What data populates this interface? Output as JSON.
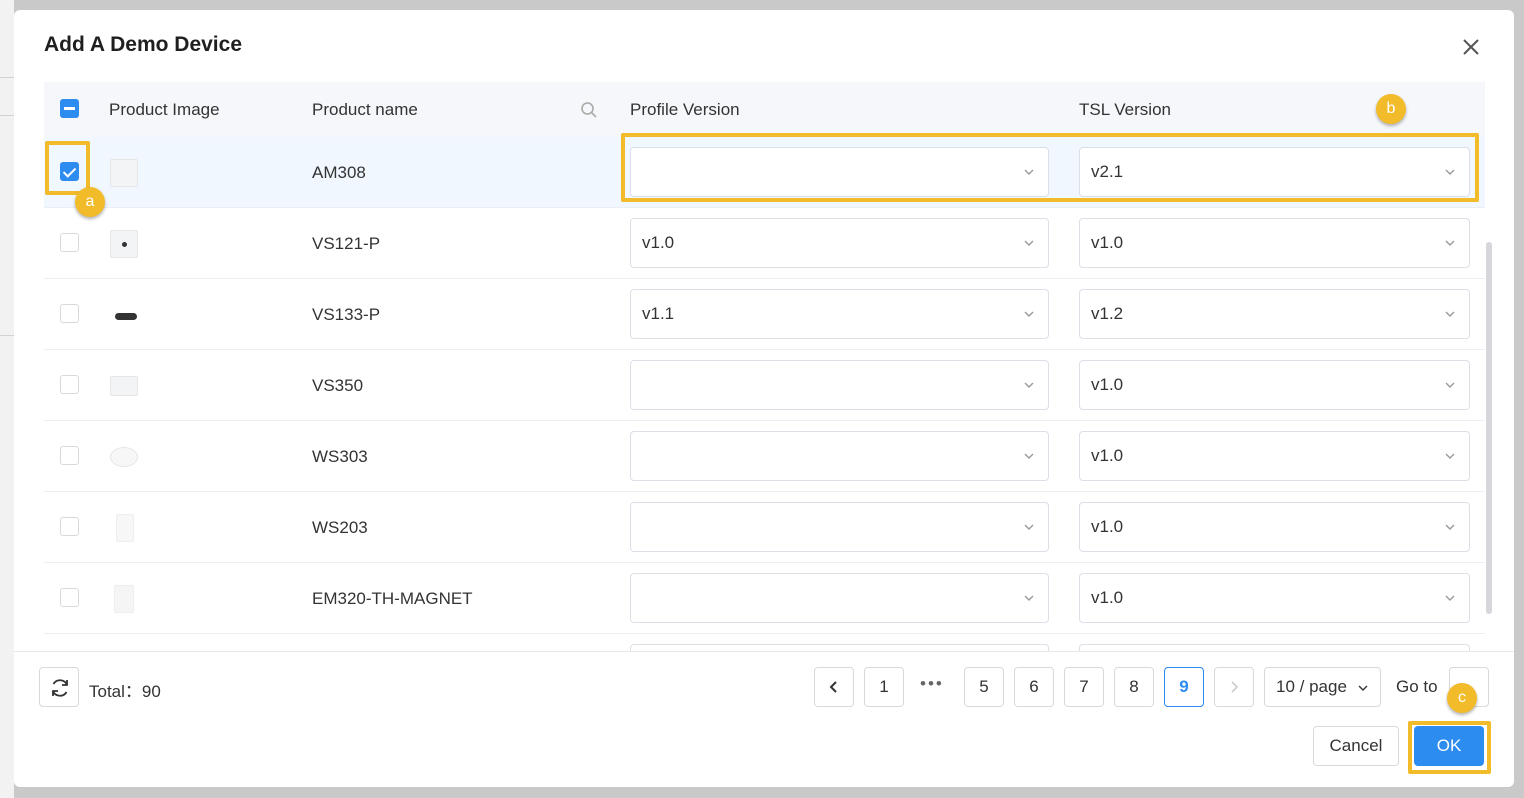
{
  "dialog": {
    "title": "Add A Demo Device"
  },
  "table": {
    "headers": {
      "image": "Product Image",
      "name": "Product name",
      "profile": "Profile Version",
      "tsl": "TSL Version"
    },
    "rows": [
      {
        "name": "AM308",
        "profile": "",
        "tsl": "v2.1",
        "checked": true
      },
      {
        "name": "VS121-P",
        "profile": "v1.0",
        "tsl": "v1.0",
        "checked": false
      },
      {
        "name": "VS133-P",
        "profile": "v1.1",
        "tsl": "v1.2",
        "checked": false
      },
      {
        "name": "VS350",
        "profile": "",
        "tsl": "v1.0",
        "checked": false
      },
      {
        "name": "WS303",
        "profile": "",
        "tsl": "v1.0",
        "checked": false
      },
      {
        "name": "WS203",
        "profile": "",
        "tsl": "v1.0",
        "checked": false
      },
      {
        "name": "EM320-TH-MAGNET",
        "profile": "",
        "tsl": "v1.0",
        "checked": false
      }
    ]
  },
  "footer": {
    "total_label": "Total：",
    "total_value": "90",
    "pages": [
      "1",
      "5",
      "6",
      "7",
      "8",
      "9"
    ],
    "ellipsis": "•••",
    "active_page": "9",
    "page_size": "10 / page",
    "goto_label": "Go to"
  },
  "actions": {
    "cancel": "Cancel",
    "ok": "OK"
  },
  "annotations": {
    "a": "a",
    "b": "b",
    "c": "c"
  },
  "colors": {
    "primary": "#2d8cf0",
    "highlight": "#f2bb2a"
  }
}
